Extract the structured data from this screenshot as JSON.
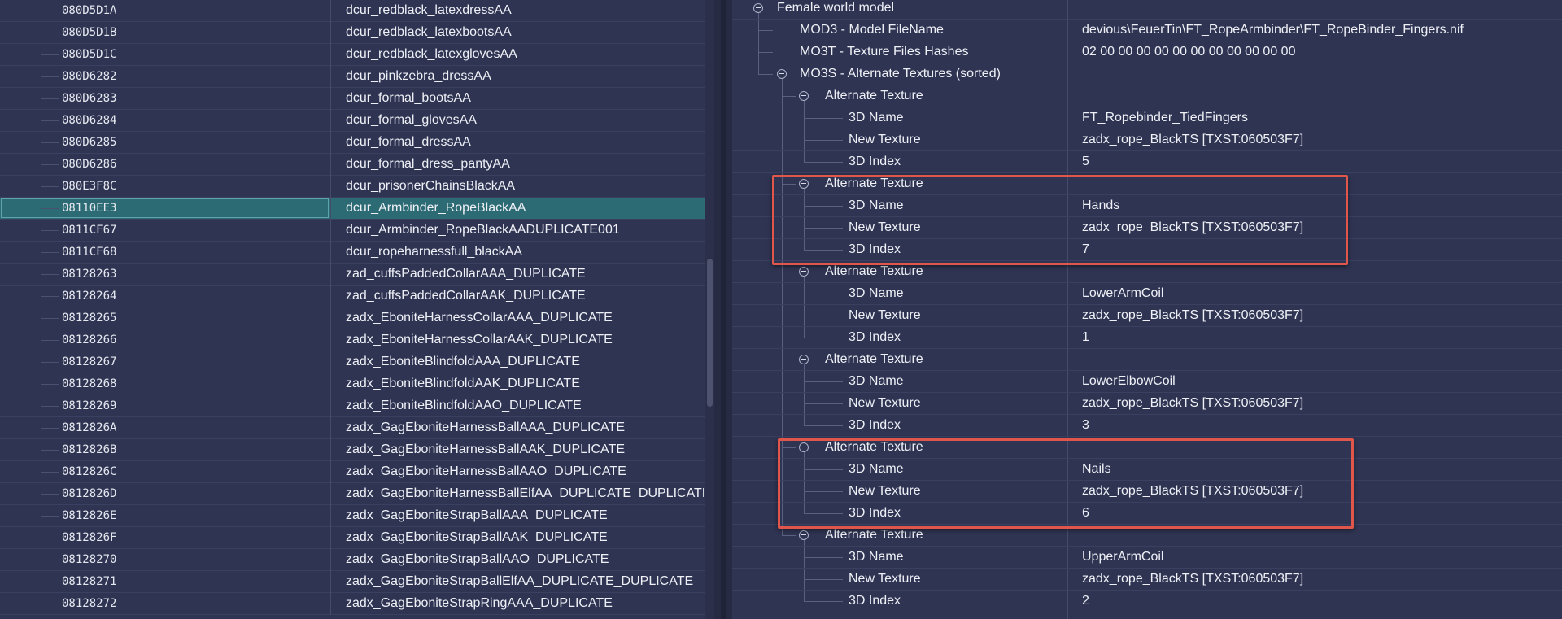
{
  "left_list": {
    "rows": [
      {
        "form_id": "080D5D1A",
        "editor_id": "dcur_redblack_latexdressAA"
      },
      {
        "form_id": "080D5D1B",
        "editor_id": "dcur_redblack_latexbootsAA"
      },
      {
        "form_id": "080D5D1C",
        "editor_id": "dcur_redblack_latexglovesAA"
      },
      {
        "form_id": "080D6282",
        "editor_id": "dcur_pinkzebra_dressAA"
      },
      {
        "form_id": "080D6283",
        "editor_id": "dcur_formal_bootsAA"
      },
      {
        "form_id": "080D6284",
        "editor_id": "dcur_formal_glovesAA"
      },
      {
        "form_id": "080D6285",
        "editor_id": "dcur_formal_dressAA"
      },
      {
        "form_id": "080D6286",
        "editor_id": "dcur_formal_dress_pantyAA"
      },
      {
        "form_id": "080E3F8C",
        "editor_id": "dcur_prisonerChainsBlackAA"
      },
      {
        "form_id": "08110EE3",
        "editor_id": "dcur_Armbinder_RopeBlackAA"
      },
      {
        "form_id": "0811CF67",
        "editor_id": "dcur_Armbinder_RopeBlackAADUPLICATE001"
      },
      {
        "form_id": "0811CF68",
        "editor_id": "dcur_ropeharnessfull_blackAA"
      },
      {
        "form_id": "08128263",
        "editor_id": "zad_cuffsPaddedCollarAAA_DUPLICATE"
      },
      {
        "form_id": "08128264",
        "editor_id": "zad_cuffsPaddedCollarAAK_DUPLICATE"
      },
      {
        "form_id": "08128265",
        "editor_id": "zadx_EboniteHarnessCollarAAA_DUPLICATE"
      },
      {
        "form_id": "08128266",
        "editor_id": "zadx_EboniteHarnessCollarAAK_DUPLICATE"
      },
      {
        "form_id": "08128267",
        "editor_id": "zadx_EboniteBlindfoldAAA_DUPLICATE"
      },
      {
        "form_id": "08128268",
        "editor_id": "zadx_EboniteBlindfoldAAK_DUPLICATE"
      },
      {
        "form_id": "08128269",
        "editor_id": "zadx_EboniteBlindfoldAAO_DUPLICATE"
      },
      {
        "form_id": "0812826A",
        "editor_id": "zadx_GagEboniteHarnessBallAAA_DUPLICATE"
      },
      {
        "form_id": "0812826B",
        "editor_id": "zadx_GagEboniteHarnessBallAAK_DUPLICATE"
      },
      {
        "form_id": "0812826C",
        "editor_id": "zadx_GagEboniteHarnessBallAAO_DUPLICATE"
      },
      {
        "form_id": "0812826D",
        "editor_id": "zadx_GagEboniteHarnessBallElfAA_DUPLICATE_DUPLICATE"
      },
      {
        "form_id": "0812826E",
        "editor_id": "zadx_GagEboniteStrapBallAAA_DUPLICATE"
      },
      {
        "form_id": "0812826F",
        "editor_id": "zadx_GagEboniteStrapBallAAK_DUPLICATE"
      },
      {
        "form_id": "08128270",
        "editor_id": "zadx_GagEboniteStrapBallAAO_DUPLICATE"
      },
      {
        "form_id": "08128271",
        "editor_id": "zadx_GagEboniteStrapBallElfAA_DUPLICATE_DUPLICATE"
      },
      {
        "form_id": "08128272",
        "editor_id": "zadx_GagEboniteStrapRingAAA_DUPLICATE"
      }
    ],
    "selected_index": 9
  },
  "tree": {
    "root_label": "Female world model",
    "mod3_label": "MOD3 - Model FileName",
    "mod3_value": "devious\\FeuerTin\\FT_RopeArmbinder\\FT_RopeBinder_Fingers.nif",
    "mo3t_label": "MO3T - Texture Files Hashes",
    "mo3t_value": "02 00 00 00 00 00 00 00 00 00 00 00",
    "mo3s_label": "MO3S - Alternate Textures (sorted)",
    "group_label": "Alternate Texture",
    "name_label": "3D Name",
    "texture_label": "New Texture",
    "index_label": "3D Index",
    "groups": [
      {
        "name": "FT_Ropebinder_TiedFingers",
        "texture": "zadx_rope_BlackTS [TXST:060503F7]",
        "index": "5"
      },
      {
        "name": "Hands",
        "texture": "zadx_rope_BlackTS [TXST:060503F7]",
        "index": "7"
      },
      {
        "name": "LowerArmCoil",
        "texture": "zadx_rope_BlackTS [TXST:060503F7]",
        "index": "1"
      },
      {
        "name": "LowerElbowCoil",
        "texture": "zadx_rope_BlackTS [TXST:060503F7]",
        "index": "3"
      },
      {
        "name": "Nails",
        "texture": "zadx_rope_BlackTS [TXST:060503F7]",
        "index": "6"
      },
      {
        "name": "UpperArmCoil",
        "texture": "zadx_rope_BlackTS [TXST:060503F7]",
        "index": "2"
      }
    ],
    "highlighted_groups": [
      1,
      4
    ]
  },
  "colors": {
    "background": "#2f3452",
    "selection": "#2c6b73",
    "highlight_border": "#e0564a"
  }
}
